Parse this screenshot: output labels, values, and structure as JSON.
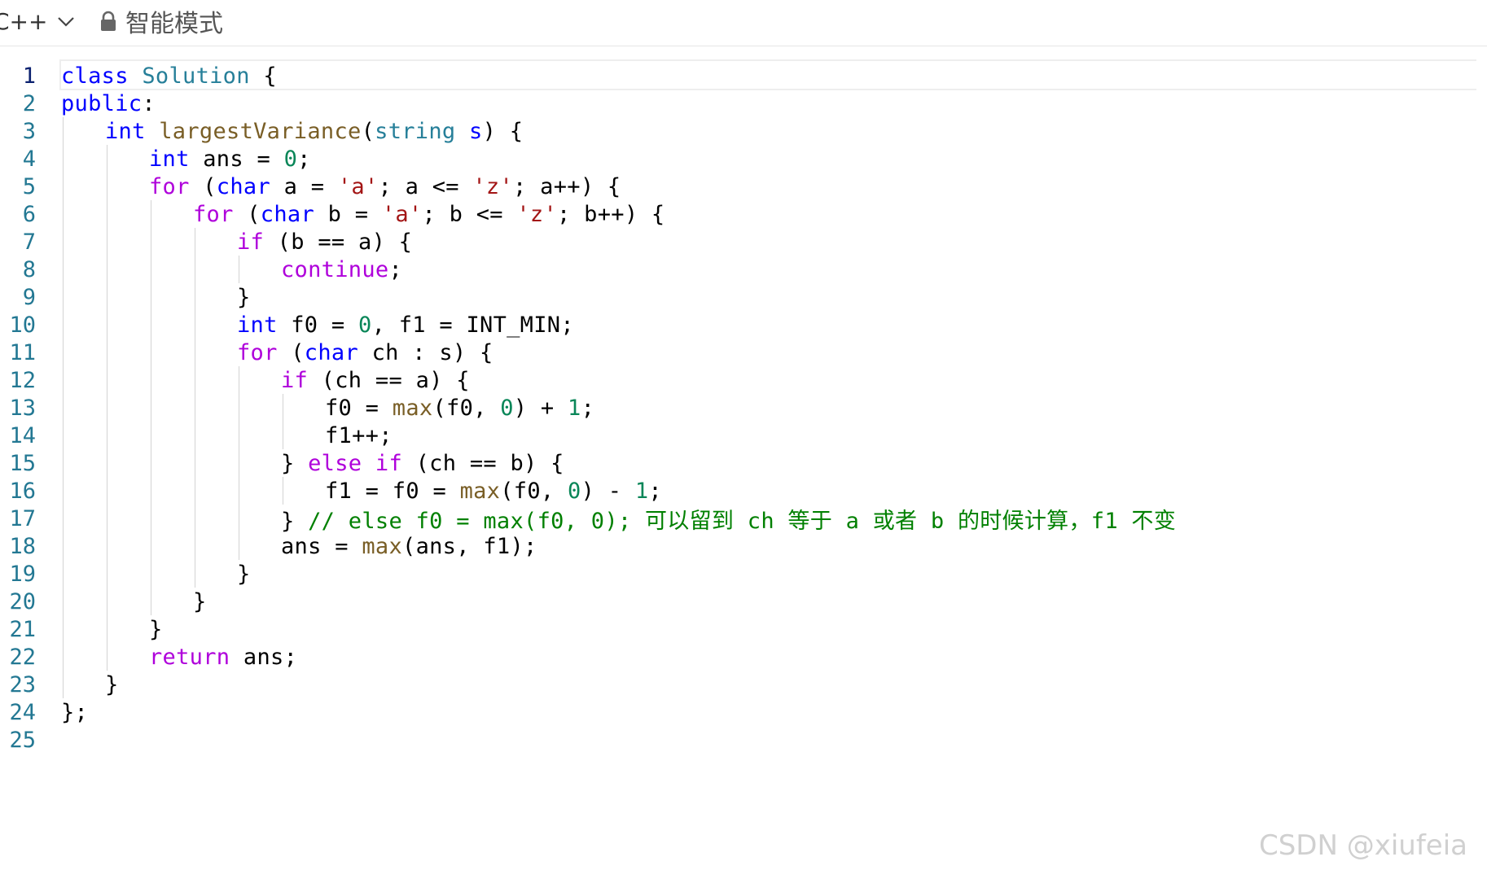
{
  "toolbar": {
    "language": "C++",
    "mode_label": "智能模式"
  },
  "editor": {
    "active_line": 1,
    "lines": [
      {
        "n": "1",
        "indent": 0,
        "tokens": [
          [
            "kw",
            "class"
          ],
          [
            "t",
            " "
          ],
          [
            "ty",
            "Solution"
          ],
          [
            "t",
            " {"
          ]
        ]
      },
      {
        "n": "2",
        "indent": 0,
        "tokens": [
          [
            "kw",
            "public"
          ],
          [
            "t",
            ":"
          ]
        ]
      },
      {
        "n": "3",
        "indent": 1,
        "tokens": [
          [
            "kw",
            "int"
          ],
          [
            "t",
            " "
          ],
          [
            "fn",
            "largestVariance"
          ],
          [
            "t",
            "("
          ],
          [
            "ty",
            "string"
          ],
          [
            "t",
            " "
          ],
          [
            "kw",
            "s"
          ],
          [
            "t",
            ") {"
          ]
        ]
      },
      {
        "n": "4",
        "indent": 2,
        "tokens": [
          [
            "kw",
            "int"
          ],
          [
            "t",
            " ans = "
          ],
          [
            "num",
            "0"
          ],
          [
            "t",
            ";"
          ]
        ]
      },
      {
        "n": "5",
        "indent": 2,
        "tokens": [
          [
            "ctl",
            "for"
          ],
          [
            "t",
            " ("
          ],
          [
            "kw",
            "char"
          ],
          [
            "t",
            " a = "
          ],
          [
            "str",
            "'a'"
          ],
          [
            "t",
            "; a <= "
          ],
          [
            "str",
            "'z'"
          ],
          [
            "t",
            "; a++) {"
          ]
        ]
      },
      {
        "n": "6",
        "indent": 3,
        "tokens": [
          [
            "ctl",
            "for"
          ],
          [
            "t",
            " ("
          ],
          [
            "kw",
            "char"
          ],
          [
            "t",
            " b = "
          ],
          [
            "str",
            "'a'"
          ],
          [
            "t",
            "; b <= "
          ],
          [
            "str",
            "'z'"
          ],
          [
            "t",
            "; b++) {"
          ]
        ]
      },
      {
        "n": "7",
        "indent": 4,
        "tokens": [
          [
            "ctl",
            "if"
          ],
          [
            "t",
            " (b == a) {"
          ]
        ]
      },
      {
        "n": "8",
        "indent": 5,
        "tokens": [
          [
            "ctl",
            "continue"
          ],
          [
            "t",
            ";"
          ]
        ]
      },
      {
        "n": "9",
        "indent": 4,
        "tokens": [
          [
            "t",
            "}"
          ]
        ]
      },
      {
        "n": "10",
        "indent": 4,
        "tokens": [
          [
            "kw",
            "int"
          ],
          [
            "t",
            " f0 = "
          ],
          [
            "num",
            "0"
          ],
          [
            "t",
            ", f1 = INT_MIN;"
          ]
        ]
      },
      {
        "n": "11",
        "indent": 4,
        "tokens": [
          [
            "ctl",
            "for"
          ],
          [
            "t",
            " ("
          ],
          [
            "kw",
            "char"
          ],
          [
            "t",
            " ch : s) {"
          ]
        ]
      },
      {
        "n": "12",
        "indent": 5,
        "tokens": [
          [
            "ctl",
            "if"
          ],
          [
            "t",
            " (ch == a) {"
          ]
        ]
      },
      {
        "n": "13",
        "indent": 6,
        "tokens": [
          [
            "t",
            "f0 = "
          ],
          [
            "fn",
            "max"
          ],
          [
            "t",
            "(f0, "
          ],
          [
            "num",
            "0"
          ],
          [
            "t",
            ") + "
          ],
          [
            "num",
            "1"
          ],
          [
            "t",
            ";"
          ]
        ]
      },
      {
        "n": "14",
        "indent": 6,
        "tokens": [
          [
            "t",
            "f1++;"
          ]
        ]
      },
      {
        "n": "15",
        "indent": 5,
        "tokens": [
          [
            "t",
            "} "
          ],
          [
            "ctl",
            "else"
          ],
          [
            "t",
            " "
          ],
          [
            "ctl",
            "if"
          ],
          [
            "t",
            " (ch == b) {"
          ]
        ]
      },
      {
        "n": "16",
        "indent": 6,
        "tokens": [
          [
            "t",
            "f1 = f0 = "
          ],
          [
            "fn",
            "max"
          ],
          [
            "t",
            "(f0, "
          ],
          [
            "num",
            "0"
          ],
          [
            "t",
            ") - "
          ],
          [
            "num",
            "1"
          ],
          [
            "t",
            ";"
          ]
        ]
      },
      {
        "n": "17",
        "indent": 5,
        "tokens": [
          [
            "t",
            "} "
          ],
          [
            "cm",
            "// else f0 = max(f0, 0); 可以留到 ch 等于 a 或者 b 的时候计算，f1 不变"
          ]
        ]
      },
      {
        "n": "18",
        "indent": 5,
        "tokens": [
          [
            "t",
            "ans = "
          ],
          [
            "fn",
            "max"
          ],
          [
            "t",
            "(ans, f1);"
          ]
        ]
      },
      {
        "n": "19",
        "indent": 4,
        "tokens": [
          [
            "t",
            "}"
          ]
        ]
      },
      {
        "n": "20",
        "indent": 3,
        "tokens": [
          [
            "t",
            "}"
          ]
        ]
      },
      {
        "n": "21",
        "indent": 2,
        "tokens": [
          [
            "t",
            "}"
          ]
        ]
      },
      {
        "n": "22",
        "indent": 2,
        "tokens": [
          [
            "ctl",
            "return"
          ],
          [
            "t",
            " ans;"
          ]
        ]
      },
      {
        "n": "23",
        "indent": 1,
        "tokens": [
          [
            "t",
            "}"
          ]
        ]
      },
      {
        "n": "24",
        "indent": 0,
        "tokens": [
          [
            "t",
            "};"
          ]
        ]
      },
      {
        "n": "25",
        "indent": 0,
        "tokens": []
      }
    ]
  },
  "watermark": "CSDN @xiufeia"
}
